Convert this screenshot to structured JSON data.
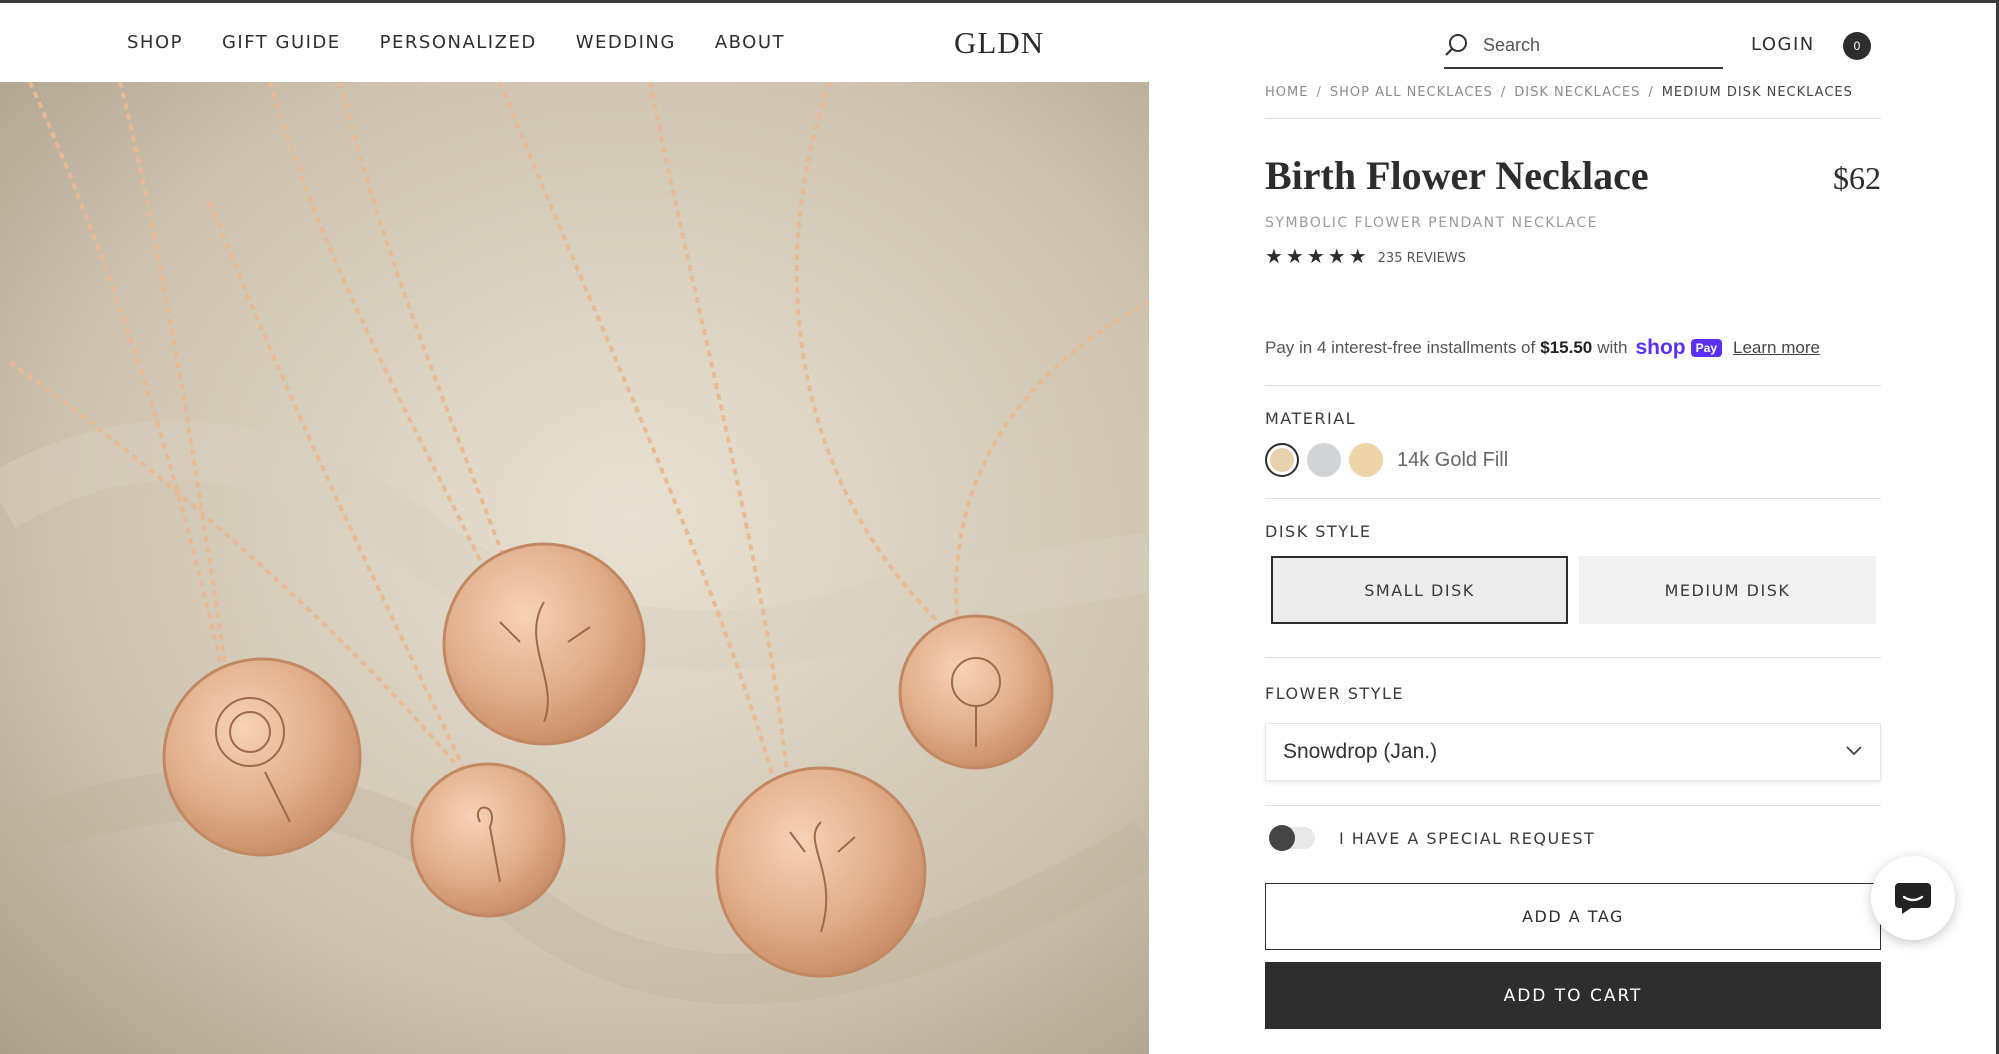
{
  "nav": {
    "items": [
      "SHOP",
      "GIFT GUIDE",
      "PERSONALIZED",
      "WEDDING",
      "ABOUT"
    ],
    "logo": "GLDN",
    "search_placeholder": "Search",
    "login": "LOGIN",
    "cart_count": "0"
  },
  "breadcrumb": {
    "items": [
      "HOME",
      "SHOP ALL NECKLACES",
      "DISK NECKLACES",
      "MEDIUM DISK NECKLACES"
    ],
    "separator": "/"
  },
  "product": {
    "title": "Birth Flower Necklace",
    "price": "$62",
    "subtitle": "SYMBOLIC FLOWER PENDANT NECKLACE",
    "stars": "★★★★★",
    "rating_value": 5,
    "reviews": "235 REVIEWS"
  },
  "installments": {
    "prefix": "Pay in 4 interest-free installments of",
    "amount": "$15.50",
    "with": "with",
    "shop": "shop",
    "pay": "Pay",
    "learn_more": "Learn more"
  },
  "material": {
    "label": "MATERIAL",
    "options": [
      {
        "color": "#e8d2ad",
        "selected": true
      },
      {
        "color": "#d2d3d5",
        "selected": false
      },
      {
        "color": "#ecd4a6",
        "selected": false
      }
    ],
    "selected_name": "14k Gold Fill"
  },
  "disk_style": {
    "label": "DISK STYLE",
    "options": [
      "SMALL DISK",
      "MEDIUM DISK"
    ],
    "selected": "SMALL DISK"
  },
  "flower_style": {
    "label": "FLOWER STYLE",
    "value": "Snowdrop (Jan.)"
  },
  "special_request": {
    "label": "I HAVE A SPECIAL REQUEST",
    "enabled": false
  },
  "buttons": {
    "add_tag": "ADD A TAG",
    "add_to_cart": "ADD TO CART"
  },
  "colors": {
    "accent": "#2e2e2e",
    "shop_pay": "#5a31f4"
  }
}
